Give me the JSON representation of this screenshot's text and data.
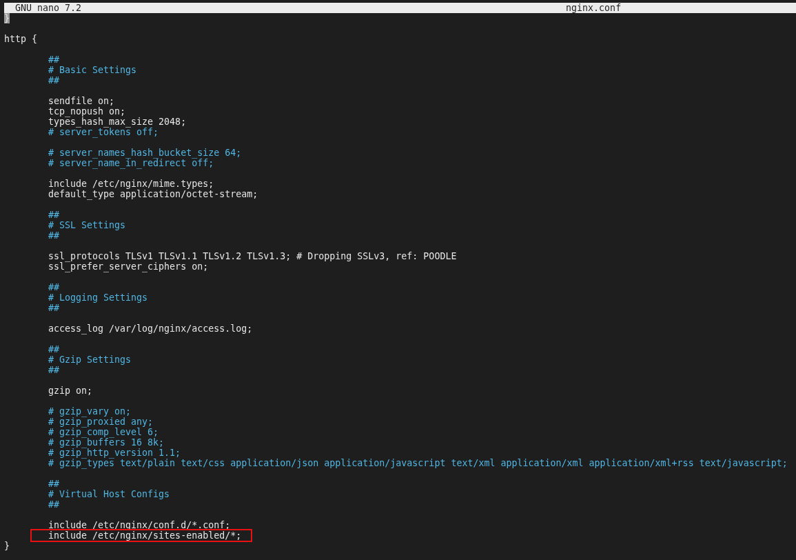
{
  "title_bar": {
    "app": "GNU nano 7.2",
    "file": "nginx.conf"
  },
  "lines": [
    {
      "kind": "code",
      "text": "}",
      "cursor": true,
      "marked": false
    },
    {
      "kind": "blank",
      "cursor": false,
      "marked": false
    },
    {
      "kind": "code",
      "text": "http {",
      "cursor": false,
      "marked": false
    },
    {
      "kind": "blank",
      "cursor": false,
      "marked": false
    },
    {
      "kind": "comment",
      "text": "        ##",
      "cursor": false,
      "marked": false
    },
    {
      "kind": "comment",
      "text": "        # Basic Settings",
      "cursor": false,
      "marked": false
    },
    {
      "kind": "comment",
      "text": "        ##",
      "cursor": false,
      "marked": false
    },
    {
      "kind": "blank",
      "cursor": false,
      "marked": false
    },
    {
      "kind": "code",
      "text": "        sendfile on;",
      "cursor": false,
      "marked": false
    },
    {
      "kind": "code",
      "text": "        tcp_nopush on;",
      "cursor": false,
      "marked": false
    },
    {
      "kind": "code",
      "text": "        types_hash_max_size 2048;",
      "cursor": false,
      "marked": false
    },
    {
      "kind": "comment",
      "text": "        # server_tokens off;",
      "cursor": false,
      "marked": false
    },
    {
      "kind": "blank",
      "cursor": false,
      "marked": false
    },
    {
      "kind": "comment",
      "text": "        # server_names_hash_bucket_size 64;",
      "cursor": false,
      "marked": false
    },
    {
      "kind": "comment",
      "text": "        # server_name_in_redirect off;",
      "cursor": false,
      "marked": false
    },
    {
      "kind": "blank",
      "cursor": false,
      "marked": false
    },
    {
      "kind": "code",
      "text": "        include /etc/nginx/mime.types;",
      "cursor": false,
      "marked": false
    },
    {
      "kind": "code",
      "text": "        default_type application/octet-stream;",
      "cursor": false,
      "marked": false
    },
    {
      "kind": "blank",
      "cursor": false,
      "marked": false
    },
    {
      "kind": "comment",
      "text": "        ##",
      "cursor": false,
      "marked": false
    },
    {
      "kind": "comment",
      "text": "        # SSL Settings",
      "cursor": false,
      "marked": false
    },
    {
      "kind": "comment",
      "text": "        ##",
      "cursor": false,
      "marked": false
    },
    {
      "kind": "blank",
      "cursor": false,
      "marked": false
    },
    {
      "kind": "code",
      "text": "        ssl_protocols TLSv1 TLSv1.1 TLSv1.2 TLSv1.3; # Dropping SSLv3, ref: POODLE",
      "cursor": false,
      "marked": false
    },
    {
      "kind": "code",
      "text": "        ssl_prefer_server_ciphers on;",
      "cursor": false,
      "marked": false
    },
    {
      "kind": "blank",
      "cursor": false,
      "marked": false
    },
    {
      "kind": "comment",
      "text": "        ##",
      "cursor": false,
      "marked": false
    },
    {
      "kind": "comment",
      "text": "        # Logging Settings",
      "cursor": false,
      "marked": false
    },
    {
      "kind": "comment",
      "text": "        ##",
      "cursor": false,
      "marked": false
    },
    {
      "kind": "blank",
      "cursor": false,
      "marked": false
    },
    {
      "kind": "code",
      "text": "        access_log /var/log/nginx/access.log;",
      "cursor": false,
      "marked": false
    },
    {
      "kind": "blank",
      "cursor": false,
      "marked": false
    },
    {
      "kind": "comment",
      "text": "        ##",
      "cursor": false,
      "marked": false
    },
    {
      "kind": "comment",
      "text": "        # Gzip Settings",
      "cursor": false,
      "marked": false
    },
    {
      "kind": "comment",
      "text": "        ##",
      "cursor": false,
      "marked": false
    },
    {
      "kind": "blank",
      "cursor": false,
      "marked": false
    },
    {
      "kind": "code",
      "text": "        gzip on;",
      "cursor": false,
      "marked": false
    },
    {
      "kind": "blank",
      "cursor": false,
      "marked": false
    },
    {
      "kind": "comment",
      "text": "        # gzip_vary on;",
      "cursor": false,
      "marked": false
    },
    {
      "kind": "comment",
      "text": "        # gzip_proxied any;",
      "cursor": false,
      "marked": false
    },
    {
      "kind": "comment",
      "text": "        # gzip_comp_level 6;",
      "cursor": false,
      "marked": false
    },
    {
      "kind": "comment",
      "text": "        # gzip_buffers 16 8k;",
      "cursor": false,
      "marked": false
    },
    {
      "kind": "comment",
      "text": "        # gzip_http_version 1.1;",
      "cursor": false,
      "marked": false
    },
    {
      "kind": "comment",
      "text": "        # gzip_types text/plain text/css application/json application/javascript text/xml application/xml application/xml+rss text/javascript;",
      "cursor": false,
      "marked": false
    },
    {
      "kind": "blank",
      "cursor": false,
      "marked": false
    },
    {
      "kind": "comment",
      "text": "        ##",
      "cursor": false,
      "marked": false
    },
    {
      "kind": "comment",
      "text": "        # Virtual Host Configs",
      "cursor": false,
      "marked": false
    },
    {
      "kind": "comment",
      "text": "        ##",
      "cursor": false,
      "marked": false
    },
    {
      "kind": "blank",
      "cursor": false,
      "marked": false
    },
    {
      "kind": "code",
      "text": "        include /etc/nginx/conf.d/*.conf;",
      "cursor": false,
      "marked": false
    },
    {
      "kind": "code",
      "text": "        include /etc/nginx/sites-enabled/*;",
      "cursor": false,
      "marked": true
    },
    {
      "kind": "code",
      "text": "}",
      "cursor": false,
      "marked": false
    }
  ]
}
